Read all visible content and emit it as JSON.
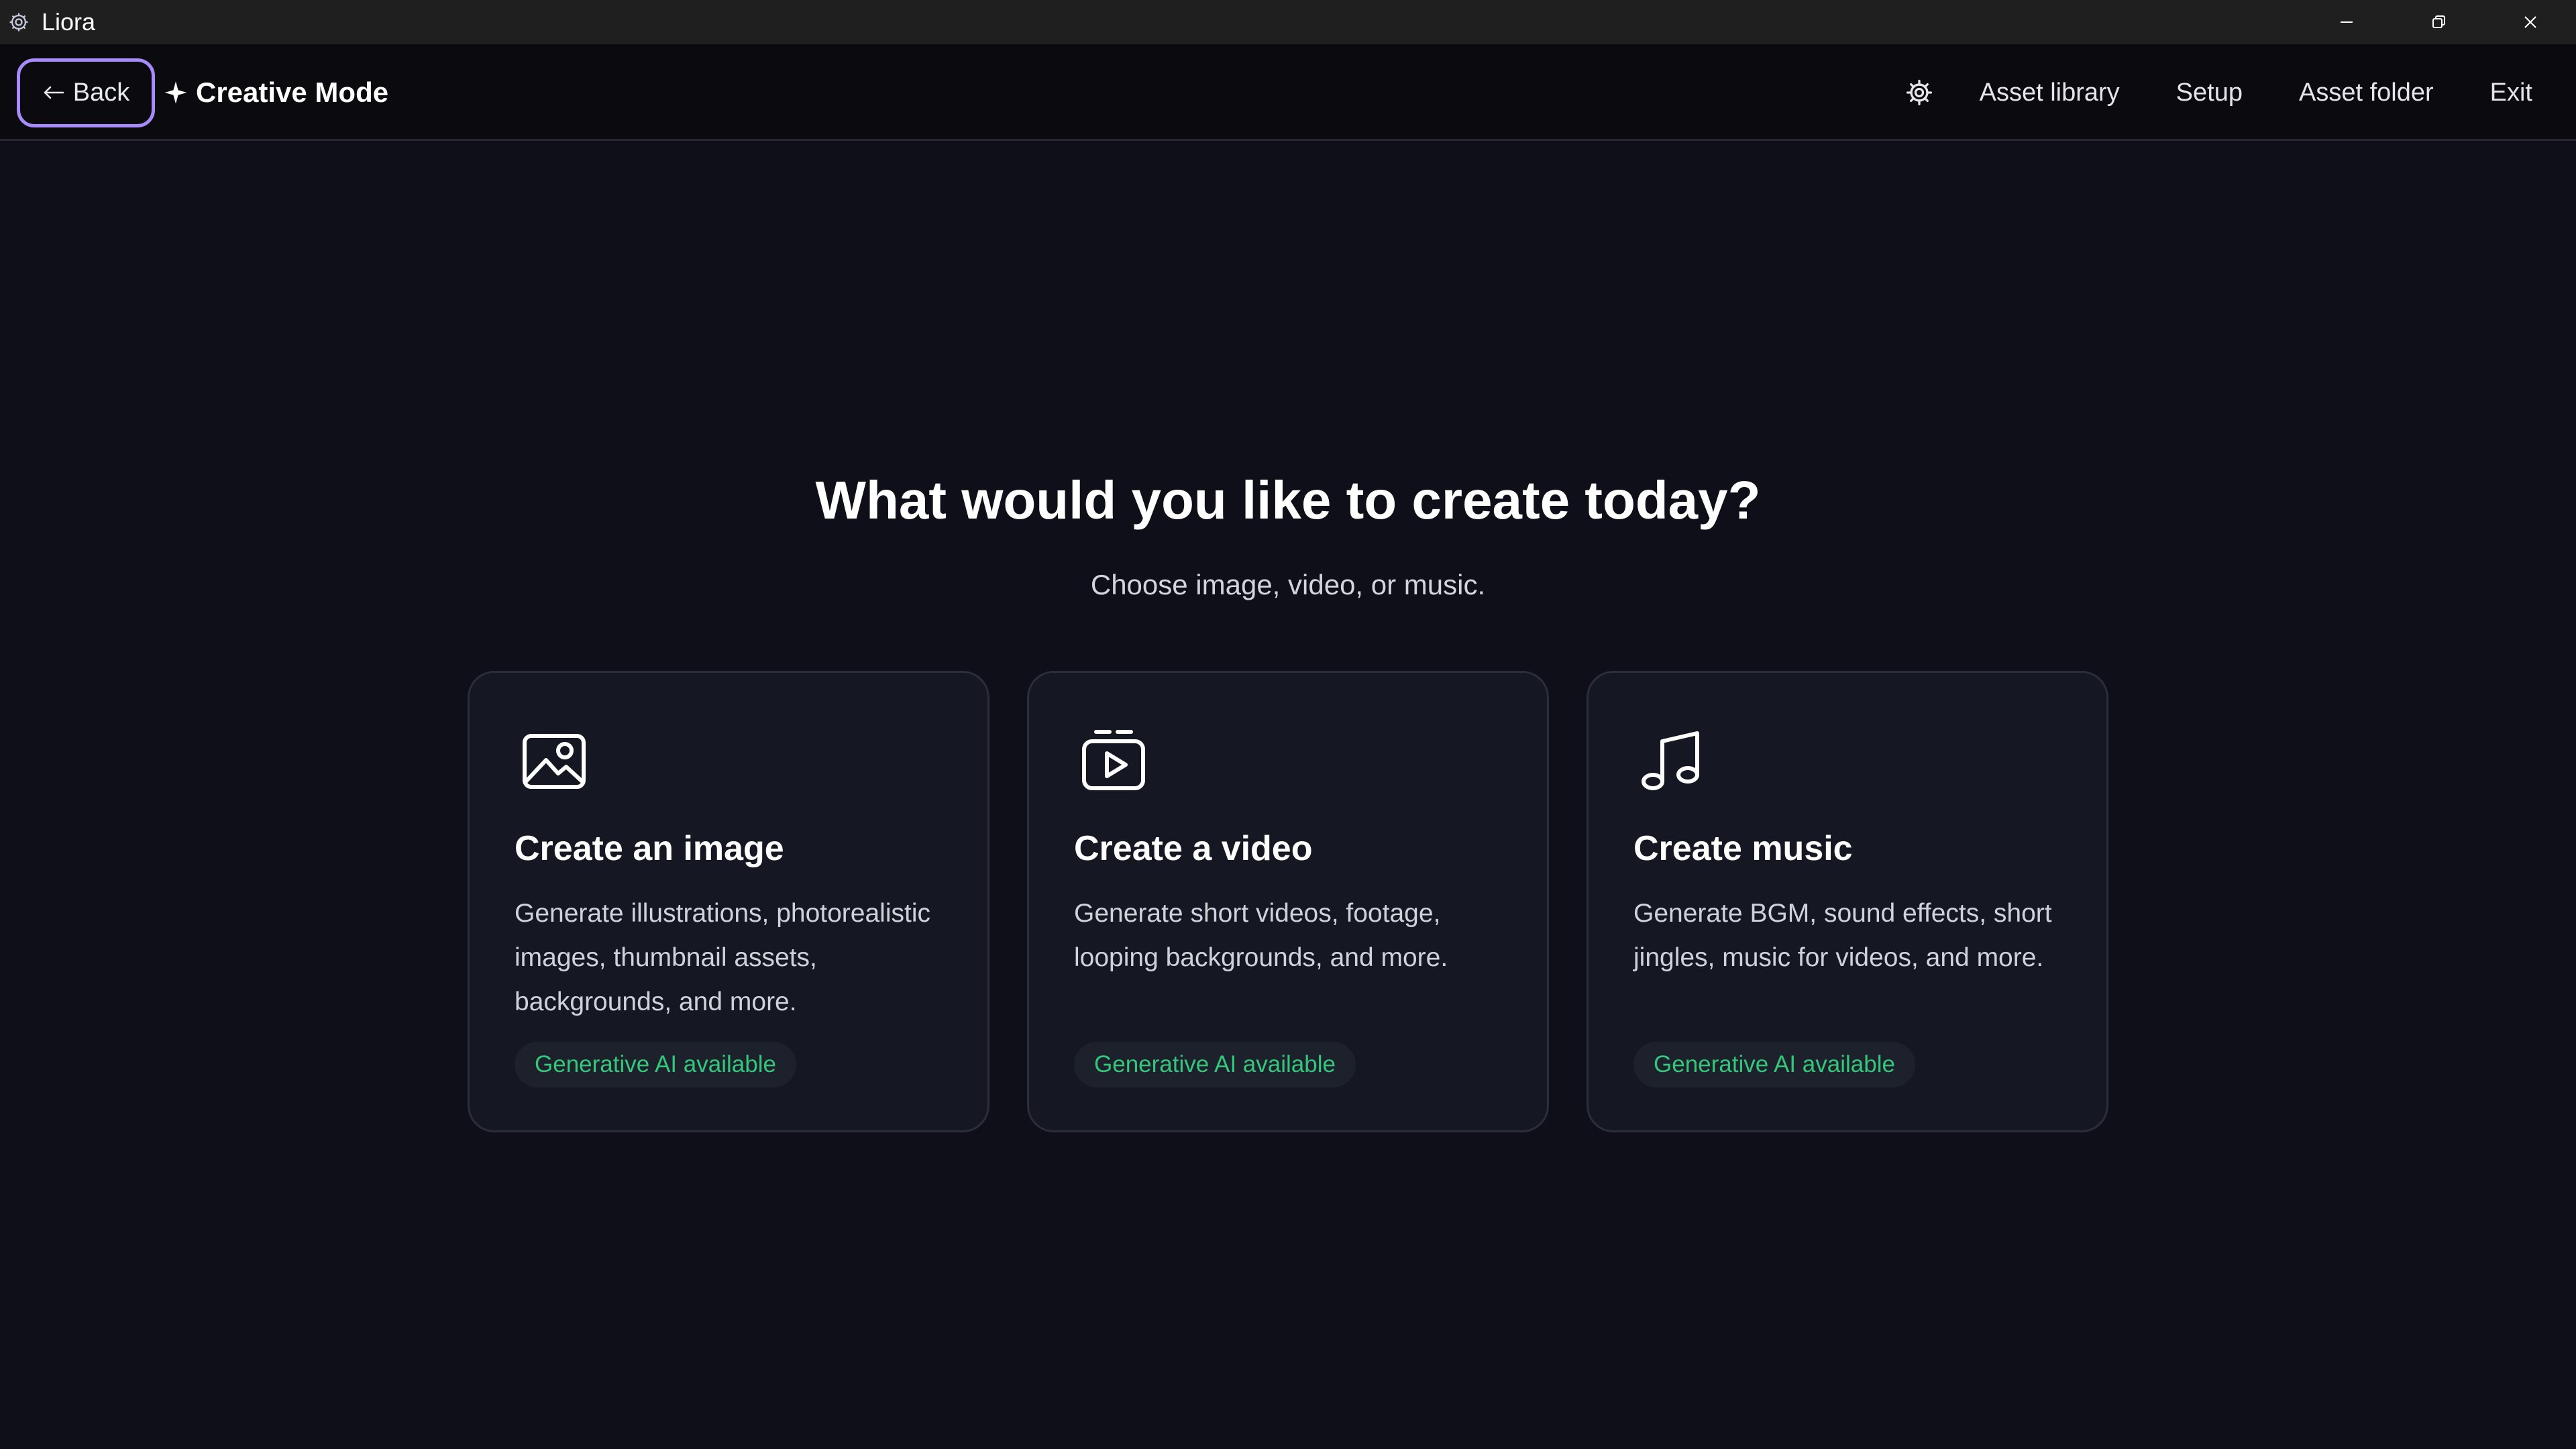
{
  "window": {
    "title": "Liora",
    "app_icon": "gear-app-icon",
    "controls": [
      "minimize-icon",
      "restore-icon",
      "close-icon"
    ]
  },
  "header": {
    "back_label": "Back",
    "back_icon": "arrow-left-icon",
    "brand_icon": "sparkle-icon",
    "brand_label": "Creative Mode",
    "settings_icon": "gear-icon",
    "nav": [
      "Asset library",
      "Setup",
      "Asset folder",
      "Exit"
    ]
  },
  "main": {
    "heading": "What would you like to create today?",
    "subheading": "Choose image, video, or music.",
    "cards": [
      {
        "icon": "image-icon",
        "title": "Create an image",
        "description": "Generate illustrations, photorealistic images, thumbnail assets, backgrounds, and more.",
        "badge": "Generative AI available"
      },
      {
        "icon": "video-icon",
        "title": "Create a video",
        "description": "Generate short videos, footage, looping backgrounds, and more.",
        "badge": "Generative AI available"
      },
      {
        "icon": "music-note-icon",
        "title": "Create music",
        "description": "Generate BGM, sound effects, short jingles, music for videos, and more.",
        "badge": "Generative AI available"
      }
    ]
  },
  "colors": {
    "background": "#0e0f18",
    "titlebar": "#1f1f1f",
    "accent": "#a78bfa",
    "badge_text": "#34c77b",
    "card": "#151822"
  }
}
